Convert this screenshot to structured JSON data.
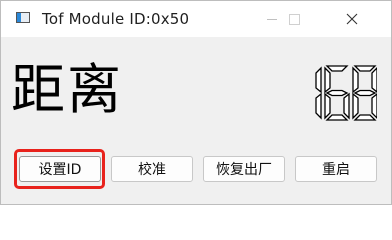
{
  "window": {
    "title": "Tof Module ID:0x50",
    "icon": "app-window-icon",
    "controls": [
      "minimize-icon",
      "maximize-icon",
      "close-icon"
    ]
  },
  "display": {
    "label": "距离",
    "value": "168"
  },
  "buttons": {
    "set_id": "设置ID",
    "calibrate": "校准",
    "factory_reset": "恢复出厂",
    "restart": "重启"
  },
  "annotation": {
    "highlight_color": "#e8221c",
    "highlighted": "set-id-button"
  },
  "colors": {
    "window_bg": "#f0f0f0",
    "titlebar_bg": "#ffffff",
    "text": "#000000"
  }
}
